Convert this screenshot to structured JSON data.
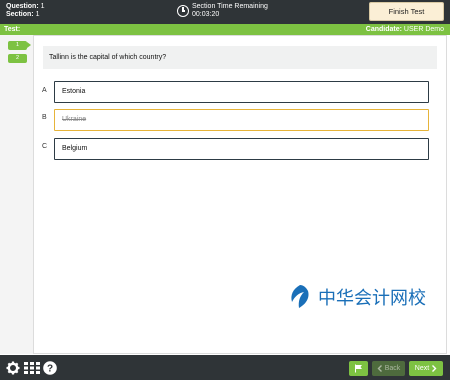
{
  "header": {
    "question_label": "Question:",
    "question_value": "1",
    "section_label": "Section:",
    "section_value": "1",
    "timer_label": "Section Time Remaining",
    "timer_value": "00:03:20",
    "finish_label": "Finish Test"
  },
  "subheader": {
    "test_label": "Test:",
    "candidate_label": "Candidate:",
    "candidate_value": "USER Demo"
  },
  "nav": {
    "questions": [
      "1",
      "2"
    ]
  },
  "question": {
    "text": "Tallinn is the capital of which country?",
    "options": [
      {
        "letter": "A",
        "text": "Estonia",
        "crossed_out": false
      },
      {
        "letter": "B",
        "text": "Ukraine",
        "crossed_out": true
      },
      {
        "letter": "C",
        "text": "Belgium",
        "crossed_out": false
      }
    ]
  },
  "watermark": {
    "text": "中华会计网校"
  },
  "footer": {
    "back_label": "Back",
    "next_label": "Next"
  },
  "colors": {
    "dark_bar": "#2f3437",
    "green": "#7dc242",
    "finish_bg": "#fbefd6",
    "crossed_border": "#e6b43a"
  }
}
